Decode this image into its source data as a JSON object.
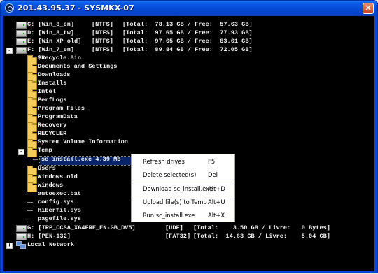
{
  "window": {
    "title": "201.43.95.37 - SYSMKX-07",
    "close_glyph": "×"
  },
  "tree": {
    "drives": [
      {
        "label": "C: [Win_8_en]",
        "fs": "[NTFS]",
        "info": "[Total:  78.13 GB / Free:  57.63 GB]"
      },
      {
        "label": "D: [Win_8_tw]",
        "fs": "[NTFS]",
        "info": "[Total:  97.65 GB / Free:  77.93 GB]"
      },
      {
        "label": "E: [Win_XP_old]",
        "fs": "[NTFS]",
        "info": "[Total:  97.65 GB / Free:  83.61 GB]"
      },
      {
        "label": "F: [Win_7_en]",
        "fs": "[NTFS]",
        "info": "[Total:  89.84 GB / Free:  72.05 GB]"
      },
      {
        "label": "G: [IRP_CCSA_X64FRE_EN-GB_DV5]",
        "fs": "[UDF]",
        "info": "[Total:    3.50 GB / Livre:   0 Bytes]"
      },
      {
        "label": "H: [PEN-132]",
        "fs": "[FAT32]",
        "info": "[Total:  14.63 GB / Livre:    5.04 GB]"
      }
    ],
    "folders_f": [
      "$Recycle.Bin",
      "Documents and Settings",
      "Downloads",
      "Installs",
      "Intel",
      "PerfLogs",
      "Program Files",
      "ProgramData",
      "Recovery",
      "RECYCLER",
      "System Volume Information",
      "Temp"
    ],
    "temp_file": "sc_install.exe 4.39 MB",
    "folders_after_temp": [
      "Users",
      "Windows.old",
      "Windows"
    ],
    "files_f": [
      "autoexec.bat",
      "config.sys",
      "hiberfil.sys",
      "pagefile.sys"
    ],
    "network": "Local Network",
    "expand_plus": "+",
    "expand_minus": "-"
  },
  "context_menu": {
    "items": [
      {
        "label": "Refresh drives",
        "shortcut": "F5"
      },
      {
        "label": "Delete selected(s)",
        "shortcut": "Del"
      },
      {
        "label": "Download sc_install.exe",
        "shortcut": "Alt+D"
      },
      {
        "label": "Upload file(s) to Temp",
        "shortcut": "Alt+U"
      },
      {
        "label": "Run sc_install.exe",
        "shortcut": "Alt+X"
      }
    ]
  },
  "colors": {
    "titlebar": "#0649d6",
    "background": "#000000",
    "text": "#f0f0f0",
    "selection": "#0a246a",
    "folder": "#f3cc5a"
  }
}
